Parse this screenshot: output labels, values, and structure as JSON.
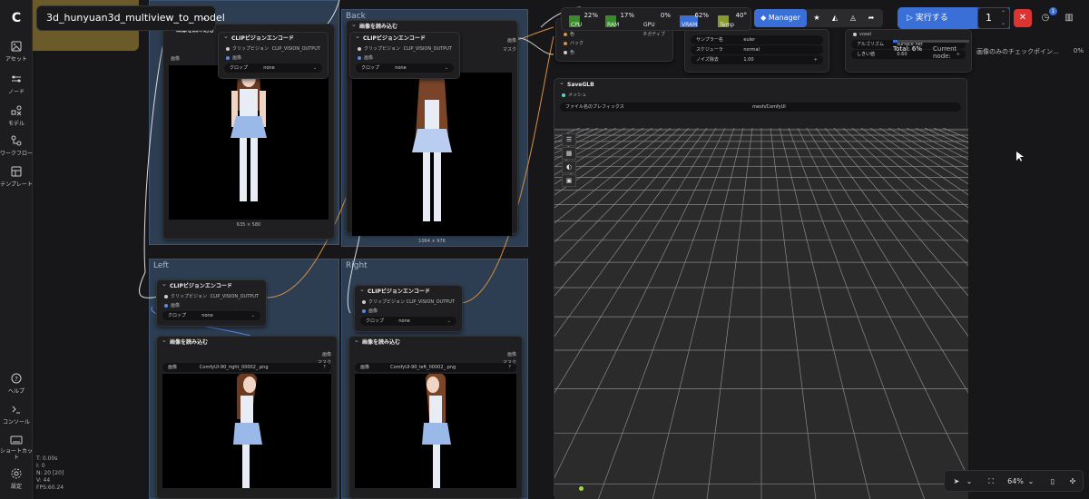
{
  "app": {
    "workflow_title": "3d_hunyuan3d_multiview_to_model"
  },
  "sidebar": {
    "items": [
      {
        "label": "アセット",
        "icon": "image-icon"
      },
      {
        "label": "ノード",
        "icon": "node-icon"
      },
      {
        "label": "モデル",
        "icon": "model-icon"
      },
      {
        "label": "ワークフロー",
        "icon": "workflow-icon"
      },
      {
        "label": "テンプレート",
        "icon": "template-icon"
      }
    ],
    "bottom_items": [
      {
        "label": "ヘルプ",
        "icon": "help-icon"
      },
      {
        "label": "コンソール",
        "icon": "console-icon"
      },
      {
        "label": "ショートカット",
        "icon": "keyboard-icon"
      },
      {
        "label": "設定",
        "icon": "gear-icon"
      }
    ]
  },
  "stats": {
    "t": "T: 0.00s",
    "i": "I: 0",
    "n": "N: 20 [20]",
    "v": "V: 44",
    "fps": "FPS:60.24"
  },
  "monitor": {
    "cpu": {
      "label": "CPU",
      "pct": "22%",
      "color": "#3a8a2a"
    },
    "ram": {
      "label": "RAM",
      "pct": "17%",
      "color": "#3a8a2a"
    },
    "gpu": {
      "label": "GPU",
      "pct": "0%",
      "color": "#3a8a2a"
    },
    "vram": {
      "label": "VRAM",
      "pct": "62%",
      "color": "#3a6fd8"
    },
    "temp": {
      "label": "Temp",
      "pct": "40°",
      "color": "#8a9a2a"
    }
  },
  "toolbar": {
    "manager": "Manager",
    "run": "実行する",
    "queue_count": "1"
  },
  "progress": {
    "total": "Total: 6%",
    "current_node_l1": "Current",
    "current_node_l2": "node:",
    "label": "画像のみのチェックポイン…",
    "pct": "0%"
  },
  "groups": {
    "back": "Back",
    "left": "Left",
    "right": "Right"
  },
  "nodes": {
    "clip_encode": "CLIPビジョンエンコード",
    "clip_in": "クリップビジョン",
    "clip_img": "画像",
    "clip_out": "CLIP_VISION_OUTPUT",
    "crop_label": "クロップ",
    "crop_value": "none",
    "load_image": "画像を読み込む",
    "out_image": "画像",
    "out_mask": "マスク",
    "img_label": "画像",
    "front_file": "ComfyUI-90_front_00002_.png",
    "front_dim": "635 × 580",
    "back_dim": "1064 × 976",
    "right_file": "ComfyUI-90_right_00002_.png",
    "left_file": "ComfyUI-90_left_00002_.png",
    "save_glb": "SaveGLB",
    "mesh_in": "メッシュ",
    "prefix_label": "ファイル名のプレフィックス",
    "prefix_value": "mesh/ComfyUI",
    "sampler_label": "サンプラー名",
    "sampler_value": "euler",
    "scheduler_label": "スケジューラ",
    "scheduler_value": "normal",
    "denoise_label": "ノイズ除去",
    "denoise_value": "1.00",
    "algo_label": "アルゴリズム",
    "algo_value": "surface net",
    "thresh_label": "しきい値",
    "thresh_value": "0.60",
    "voxel_label": "voxel",
    "blend_a": "色",
    "blend_b": "バック",
    "blend_c": "色",
    "negative": "ネガティブ",
    "mask_text": "マスク"
  },
  "zoom": "64%",
  "colors": {
    "accent": "#3b6fd8",
    "group": "#2d3e53",
    "stop": "#dd3333"
  }
}
